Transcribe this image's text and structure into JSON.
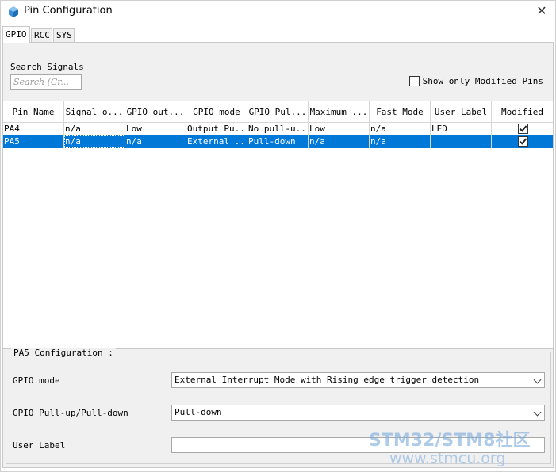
{
  "window": {
    "title": "Pin Configuration"
  },
  "tabs": [
    {
      "label": "GPIO",
      "active": true
    },
    {
      "label": "RCC",
      "active": false
    },
    {
      "label": "SYS",
      "active": false
    }
  ],
  "search": {
    "label": "Search Signals",
    "placeholder": "Search (Cr..."
  },
  "show_modified": {
    "label": "Show only Modified Pins",
    "checked": false
  },
  "table": {
    "columns": [
      "Pin Name",
      "Signal o...",
      "GPIO out...",
      "GPIO mode",
      "GPIO Pul...",
      "Maximum ...",
      "Fast Mode",
      "User Label",
      "Modified"
    ],
    "rows": [
      {
        "pin": "PA4",
        "signal": "n/a",
        "gpio_out": "Low",
        "gpio_mode": "Output Pu...",
        "gpio_pull": "No pull-u...",
        "maximum": "Low",
        "fast_mode": "n/a",
        "user_label": "LED",
        "modified": true,
        "selected": false
      },
      {
        "pin": "PA5",
        "signal": "n/a",
        "gpio_out": "n/a",
        "gpio_mode": "External ...",
        "gpio_pull": "Pull-down",
        "maximum": "n/a",
        "fast_mode": "n/a",
        "user_label": "",
        "modified": true,
        "selected": true
      }
    ]
  },
  "config": {
    "title": "PA5 Configuration :",
    "gpio_mode_label": "GPIO mode",
    "gpio_mode_value": "External Interrupt Mode with Rising edge trigger detection",
    "pull_label": "GPIO Pull-up/Pull-down",
    "pull_value": "Pull-down",
    "user_label_label": "User Label",
    "user_label_value": ""
  },
  "watermark": {
    "line1": "STM32/STM8社区",
    "line2": "www.stmcu.org"
  },
  "colors": {
    "selection": "#0078d7",
    "panel": "#f0f0f0",
    "app_icon": "#3a8fd9"
  }
}
